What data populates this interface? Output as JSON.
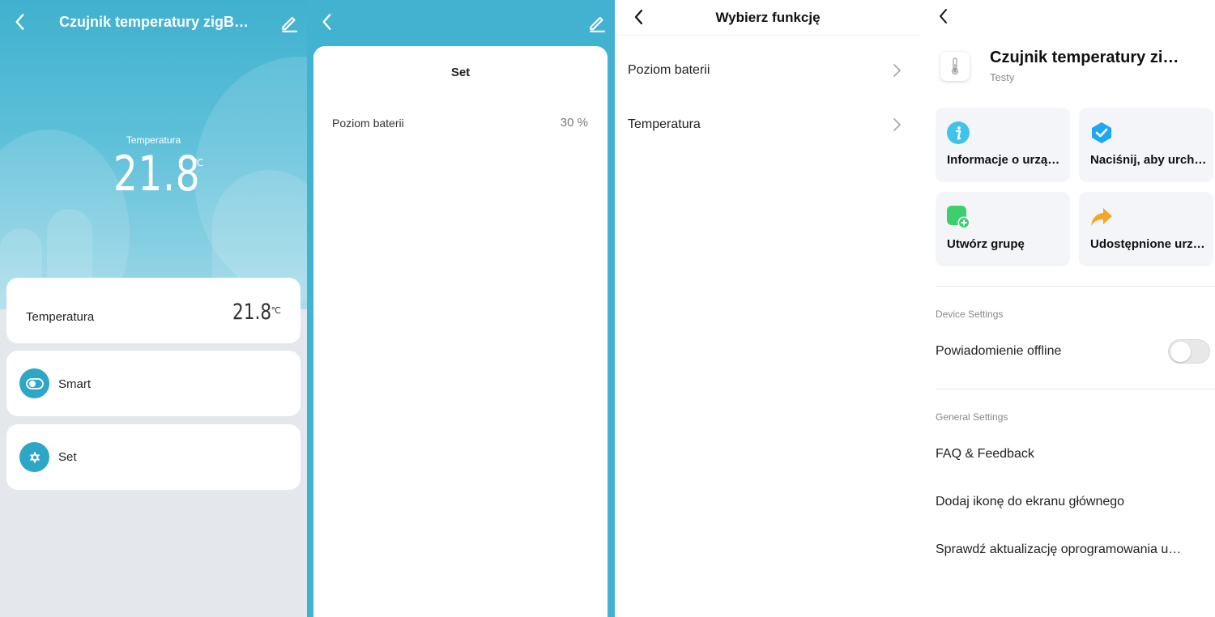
{
  "panel_device": {
    "title": "Czujnik temperatury zigB…",
    "temp_label": "Temperatura",
    "temp_value": "21.8",
    "temp_unit": "℃",
    "card_temperature": {
      "label": "Temperatura",
      "value": "21.8",
      "unit": "℃"
    },
    "card_smart": {
      "label": "Smart",
      "icon": "toggle-icon"
    },
    "card_set": {
      "label": "Set",
      "icon": "gear-icon"
    }
  },
  "panel_set": {
    "title": "Set",
    "row_label": "Poziom baterii",
    "row_value": "30 %"
  },
  "panel_functions": {
    "title": "Wybierz funkcję",
    "items": [
      {
        "label": "Poziom baterii"
      },
      {
        "label": "Temperatura"
      }
    ]
  },
  "panel_settings": {
    "device_name": "Czujnik temperatury zi…",
    "room": "Testy",
    "tiles": [
      {
        "label": "Informacje o urzą…",
        "icon": "info-icon",
        "color": "#3fc3e8"
      },
      {
        "label": "Naciśnij, aby urch…",
        "icon": "check-shield-icon",
        "color": "#1ea7f5"
      },
      {
        "label": "Utwórz grupę",
        "icon": "add-group-icon",
        "color": "#3ccf6d"
      },
      {
        "label": "Udostępnione urz…",
        "icon": "share-arrow-icon",
        "color": "#f5a623"
      }
    ],
    "device_settings_header": "Device Settings",
    "offline_notification": "Powiadomienie offline",
    "offline_toggle_on": false,
    "general_settings_header": "General Settings",
    "general_items": [
      {
        "label": "FAQ & Feedback"
      },
      {
        "label": "Dodaj ikonę do ekranu głównego"
      },
      {
        "label": "Sprawdź aktualizację oprogramowania u…"
      }
    ]
  },
  "colors": {
    "accent": "#42b2d1",
    "accent_dark": "#2ea7c6",
    "background": "#e4e7ec"
  }
}
